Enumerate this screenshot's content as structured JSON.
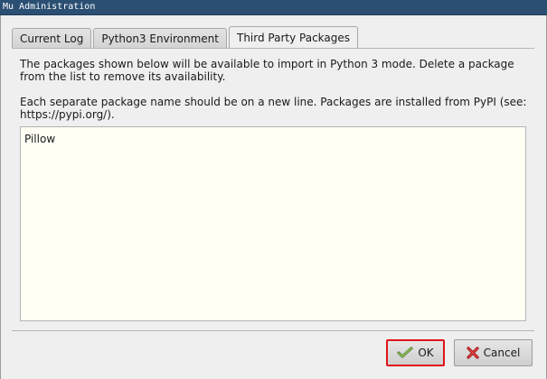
{
  "window": {
    "title": "Mu Administration"
  },
  "tabs": [
    {
      "label": "Current Log",
      "active": false
    },
    {
      "label": "Python3 Environment",
      "active": false
    },
    {
      "label": "Third Party Packages",
      "active": true
    }
  ],
  "panel": {
    "description_1": "The packages shown below will be available to import in Python 3 mode. Delete a package from the list to remove its availability.",
    "description_2": "Each separate package name should be on a new line. Packages are installed from PyPI (see: https://pypi.org/).",
    "packages": [
      "Pillow"
    ]
  },
  "buttons": {
    "ok_label": "OK",
    "ok_icon": "ok-check-icon",
    "cancel_label": "Cancel",
    "cancel_icon": "cancel-x-icon"
  },
  "colors": {
    "titlebar": "#2b4f73",
    "editor_background": "#fffff4",
    "focus_border": "#e0141c"
  }
}
